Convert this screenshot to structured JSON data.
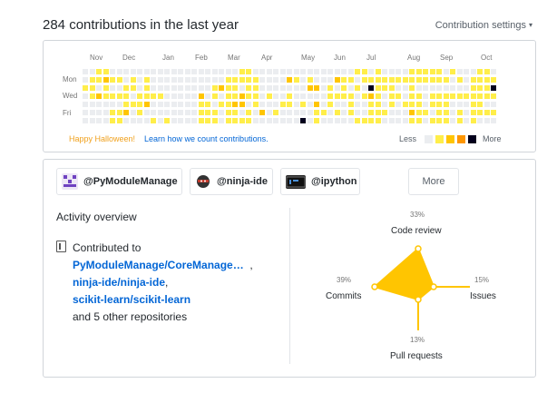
{
  "header": {
    "title": "284 contributions in the last year",
    "settings_label": "Contribution settings",
    "settings_caret": "▾"
  },
  "calendar": {
    "months": [
      "Nov",
      "Dec",
      "Jan",
      "Feb",
      "Mar",
      "Apr",
      "May",
      "Jun",
      "Jul",
      "Aug",
      "Sep",
      "Oct"
    ],
    "day_labels": [
      "Mon",
      "Wed",
      "Fri"
    ],
    "colors": [
      "#ebedf0",
      "#ffee4a",
      "#ffc501",
      "#fe9600",
      "#03001c"
    ],
    "levels": [
      "0011000000000000000000011000000000000000110100001111101000110",
      "0112110101000000000001111100002101000211011111111111110101111",
      "1101001101000000000121101100000002201010104111001000000001114",
      "0121111011110000020101121101001000001111012101101101111111111",
      "0000001112000000011011220100011010201001001101011101110001100",
      "0000112010000000011101101020100000110101001110002110110101111",
      "0000110000101000011101111000000040100000111100001101110101000"
    ],
    "footer": {
      "halloween": "Happy Halloween!",
      "learn": "Learn how we count contributions.",
      "less": "Less",
      "more": "More"
    }
  },
  "orgs": [
    {
      "label": "@PyModuleManage",
      "avatar_color": "#6f42c1"
    },
    {
      "label": "@ninja-ide",
      "avatar_color": "#333333"
    },
    {
      "label": "@ipython",
      "avatar_color": "#222222"
    }
  ],
  "orgs_more": "More",
  "activity": {
    "title": "Activity overview",
    "intro": "Contributed to",
    "repos": [
      "PyModuleManage/CoreManage…",
      "ninja-ide/ninja-ide",
      "scikit-learn/scikit-learn"
    ],
    "repo_separators": [
      ",",
      ","
    ],
    "others": "and 5 other repositories"
  },
  "radar": {
    "accent": "#ffc501",
    "code_review": {
      "label": "Code review",
      "pct": "33%"
    },
    "issues": {
      "label": "Issues",
      "pct": "15%"
    },
    "pull_requests": {
      "label": "Pull requests",
      "pct": "13%"
    },
    "commits": {
      "label": "Commits",
      "pct": "39%"
    }
  }
}
